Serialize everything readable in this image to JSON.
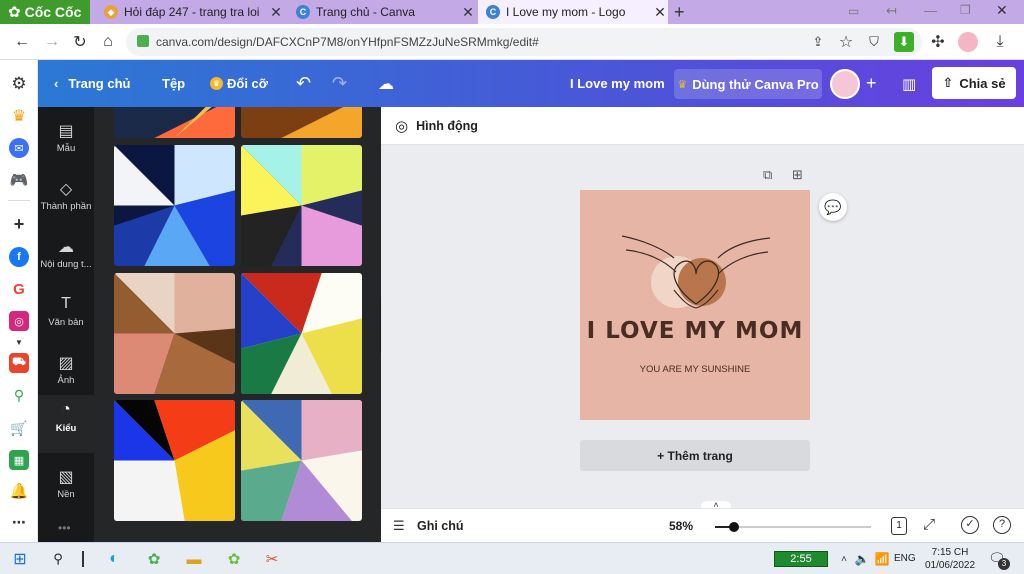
{
  "browser": {
    "brand": "Cốc Cốc",
    "tabs": [
      {
        "title": "Hỏi đáp 247 - trang tra loi",
        "active": false
      },
      {
        "title": "Trang chủ - Canva",
        "active": false
      },
      {
        "title": "I Love my mom - Logo",
        "active": true
      }
    ],
    "url": "canva.com/design/DAFCXCnP7M8/onYHfpnFSMZzJuNeSRMmkg/edit#"
  },
  "header": {
    "home": "Trang chủ",
    "file": "Tệp",
    "resize": "Đổi cỡ",
    "title": "I Love my mom",
    "pro": "Dùng thử Canva Pro",
    "share": "Chia sẻ"
  },
  "rail": [
    {
      "label": "Mẫu",
      "icon": "template-icon"
    },
    {
      "label": "Thành phần",
      "icon": "elements-icon"
    },
    {
      "label": "Nội dung t...",
      "icon": "upload-icon"
    },
    {
      "label": "Văn bản",
      "icon": "text-icon"
    },
    {
      "label": "Ảnh",
      "icon": "photo-icon"
    },
    {
      "label": "Kiểu",
      "icon": "style-icon",
      "active": true
    },
    {
      "label": "Nền",
      "icon": "background-icon"
    }
  ],
  "context": {
    "animate": "Hình động"
  },
  "design": {
    "headline": "I LOVE MY MOM",
    "subline": "YOU ARE MY SUNSHINE",
    "bg": "#e6b5a6"
  },
  "editor": {
    "add_page": "+ Thêm trang"
  },
  "footer": {
    "notes": "Ghi chú",
    "zoom": "58%",
    "zoom_fraction": 0.12,
    "page_count": "1"
  },
  "taskbar": {
    "battery": "2:55",
    "lang": "ENG",
    "time": "7:15 CH",
    "date": "01/06/2022",
    "notif": "3"
  },
  "colors": {
    "accent": "#4b55d8",
    "panel": "#252627",
    "rail": "#18191b"
  }
}
